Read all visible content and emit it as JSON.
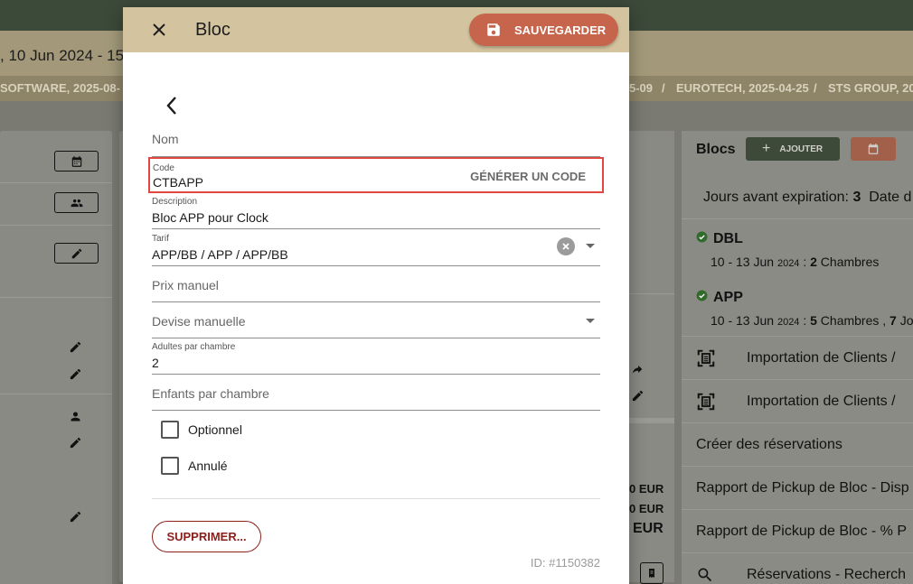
{
  "background": {
    "date_range": ", 10 Jun 2024 - 15",
    "breadcrumbs": [
      "SOFTWARE, 2025-08-",
      "5-09",
      "/",
      "EUROTECH, 2025-04-25",
      "/",
      "STS GROUP, 20"
    ],
    "middle_amounts": [
      "0 EUR",
      "0 EUR",
      "EUR"
    ],
    "right_panel": {
      "title": "Blocs",
      "add_label": "AJOUTER",
      "expiry_label": "Jours avant expiration:",
      "expiry_value": "3",
      "expiry_date_label": "Date d",
      "blocks": [
        {
          "name": "DBL",
          "dates": "10 - 13 Jun",
          "year": "2024",
          "sep": ":",
          "count": "2",
          "unit": "Chambres"
        },
        {
          "name": "APP",
          "dates": "10 - 13 Jun",
          "year": "2024",
          "sep": ":",
          "count": "5",
          "unit": "Chambres ,",
          "extra_count": "7",
          "extra_unit": "Jo"
        }
      ],
      "menu": [
        {
          "label": "Importation de Clients /",
          "icon": "scan-document-icon"
        },
        {
          "label": "Importation de Clients /",
          "icon": "scan-document-icon"
        },
        {
          "label": "Créer des réservations",
          "icon": ""
        },
        {
          "label": "Rapport de Pickup de Bloc - Disp",
          "icon": ""
        },
        {
          "label": "Rapport de Pickup de Bloc - % P",
          "icon": ""
        },
        {
          "label": "Réservations - Recherch",
          "icon": "search-icon"
        }
      ]
    }
  },
  "dialog": {
    "title": "Bloc",
    "save_label": "SAUVEGARDER",
    "fields": {
      "nom": {
        "placeholder": "Nom"
      },
      "code": {
        "label": "Code",
        "value": "CTBAPP",
        "generate_label": "GÉNÉRER UN CODE"
      },
      "description": {
        "label": "Description",
        "value": "Bloc APP pour Clock"
      },
      "tarif": {
        "label": "Tarif",
        "value": "APP/BB / APP / APP/BB"
      },
      "prix_manuel": {
        "placeholder": "Prix manuel"
      },
      "devise_manuelle": {
        "placeholder": "Devise manuelle"
      },
      "adultes": {
        "label": "Adultes par chambre",
        "value": "2"
      },
      "enfants": {
        "placeholder": "Enfants par chambre"
      }
    },
    "checkboxes": {
      "optionnel": {
        "label": "Optionnel",
        "checked": false
      },
      "annule": {
        "label": "Annulé",
        "checked": false
      }
    },
    "delete_label": "SUPPRIMER...",
    "id_text": "ID: #1150382"
  },
  "colors": {
    "header": "#d3c49f",
    "save": "#c6654b",
    "highlight": "#e0473f",
    "delete": "#8a1f1a"
  }
}
